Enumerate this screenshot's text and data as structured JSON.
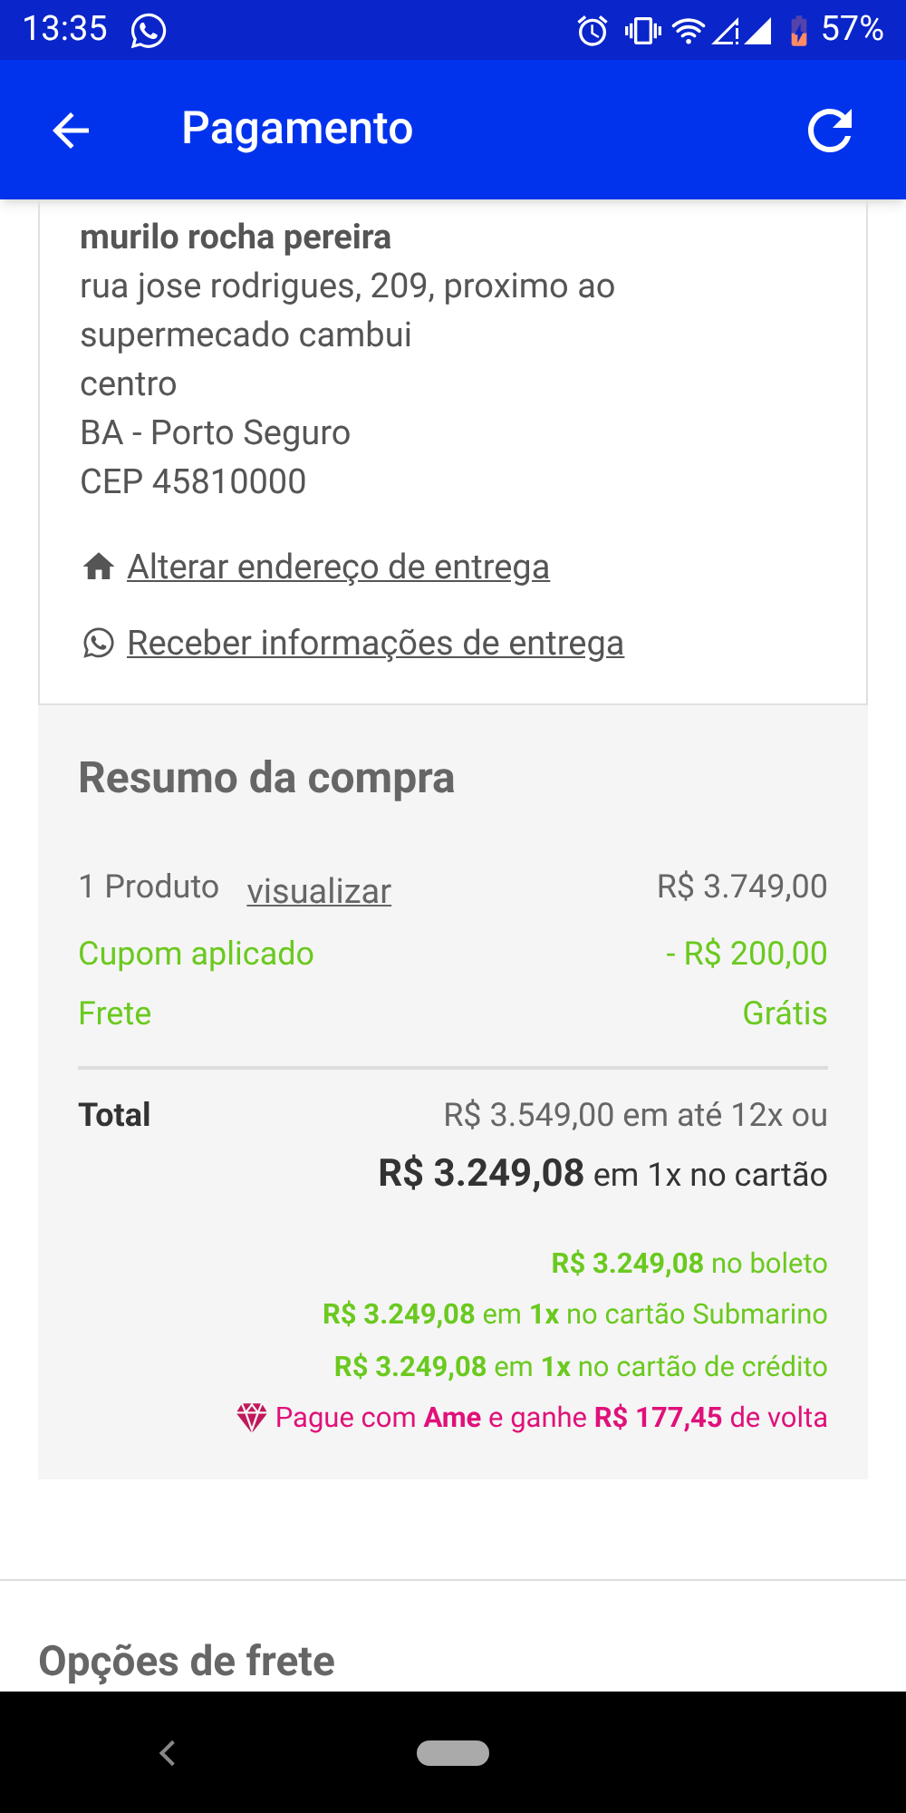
{
  "status_bar": {
    "time": "13:35",
    "battery": "57%"
  },
  "app_bar": {
    "title": "Pagamento"
  },
  "address": {
    "name": "murilo rocha pereira",
    "lines": [
      "rua jose rodrigues, 209, proximo ao",
      "supermecado cambui",
      "centro",
      "BA - Porto Seguro",
      "CEP 45810000"
    ],
    "links": [
      {
        "kind": "home",
        "label": "Alterar endereço de entrega"
      },
      {
        "kind": "whatsapp",
        "label": "Receber informações de entrega"
      }
    ]
  },
  "summary": {
    "title": "Resumo da compra",
    "rows": [
      {
        "kind": "plain",
        "label": "1 Produto",
        "link": "visualizar",
        "value": "R$ 3.749,00"
      },
      {
        "kind": "highlight",
        "label": "Cupom aplicado",
        "value": "- R$ 200,00"
      },
      {
        "kind": "highlight",
        "label": "Frete",
        "value": "Grátis"
      }
    ],
    "total": {
      "label": "Total",
      "line_1": "R$ 3.549,00 em até 12x ou",
      "line_2": "**R$ 3.249,08** em 1x no cartão"
    },
    "offers": [
      {
        "kind": "green",
        "text": "**R$ 3.249,08** no boleto"
      },
      {
        "kind": "green",
        "text": "**R$ 3.249,08** em **1x** no cartão Submarino"
      },
      {
        "kind": "green",
        "text": "**R$ 3.249,08** em **1x** no cartão de crédito"
      },
      {
        "kind": "ame",
        "text": "Pague com **Ame** e ganhe **R$ 177,45** de volta"
      }
    ]
  },
  "next_section": {
    "title": "Opções de frete"
  }
}
